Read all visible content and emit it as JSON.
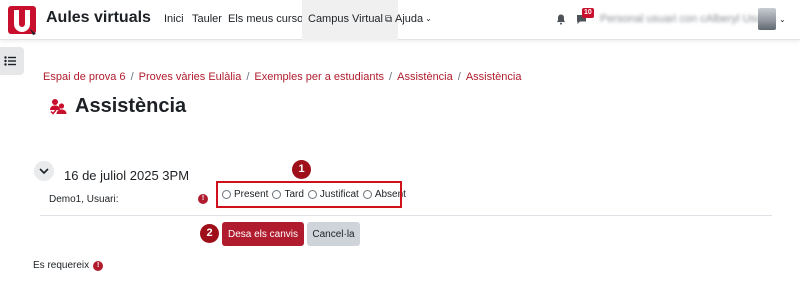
{
  "navbar": {
    "brand": "Aules virtuals",
    "items": [
      {
        "label": "Inici"
      },
      {
        "label": "Tauler"
      },
      {
        "label": "Els meus cursos"
      },
      {
        "label": "Campus Virtual"
      },
      {
        "label": "Ajuda"
      }
    ],
    "notification_count": "10",
    "user_name": "Personal usuari con cAlberyl Usuari"
  },
  "breadcrumb": [
    "Espai de prova 6",
    "Proves vàries Eulàlia",
    "Exemples per a estudiants",
    "Assistència",
    "Assistència"
  ],
  "page": {
    "title": "Assistència"
  },
  "session": {
    "title": "16 de juliol 2025 3PM",
    "student": "Demo1, Usuari:",
    "options": [
      "Present",
      "Tard",
      "Justificat",
      "Absent"
    ]
  },
  "markers": [
    "1",
    "2"
  ],
  "form": {
    "save_label": "Desa els canvis",
    "cancel_label": "Cancel·la",
    "required_label": "Es requereix"
  },
  "colors": {
    "accent": "#b01c2e",
    "highlight": "#d0111b"
  }
}
